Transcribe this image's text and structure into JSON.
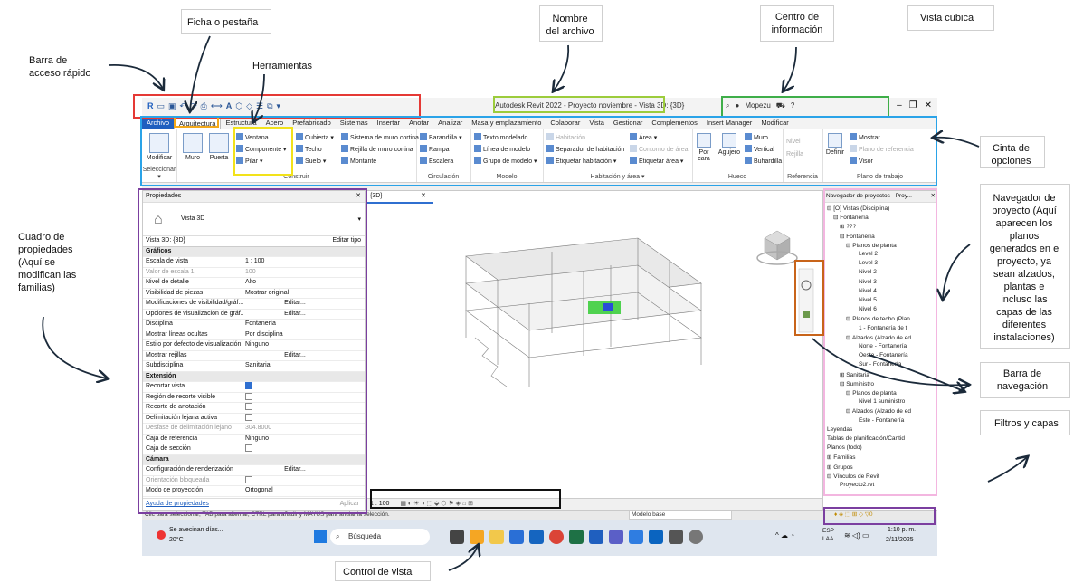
{
  "annotations": {
    "quick_access": "Barra de\nacceso rápido",
    "tab": "Ficha o pestaña",
    "tools": "Herramientas",
    "file_name": "Nombre\ndel archivo",
    "info_center": "Centro de\ninformación",
    "view_cube": "Vista cubica",
    "ribbon": "Cinta de\nopciones",
    "properties": "Cuadro de\npropiedades\n(Aquí se\nmodifican las\nfamilias)",
    "project_browser": "Navegador de\nproyecto (Aquí\naparecen los\nplanos\ngenerados en e\nproyecto, ya\nsean alzados,\nplantas e\nincluso las\ncapas de las\ndiferentes\ninstalaciones)",
    "nav_bar": "Barra de\nnavegación",
    "filters": "Filtros y capas",
    "view_control": "Control de vista"
  },
  "colors": {
    "red": "#e53935",
    "green": "#3fae49",
    "lime": "#9ccc3c",
    "blue": "#2aa3e8",
    "yellow": "#f2e21a",
    "purple": "#7b3fa0",
    "pink": "#f3b6e0",
    "orange": "#c8641a",
    "black": "#111111",
    "arrow": "#1b2a3a"
  },
  "app": {
    "title": "Autodesk Revit 2022 - Proyecto noviembre - Vista 3D: {3D}",
    "user": "Mopezu",
    "tabs": [
      "Archivo",
      "Arquitectura",
      "Estructura",
      "Acero",
      "Prefabricado",
      "Sistemas",
      "Insertar",
      "Anotar",
      "Analizar",
      "Masa y emplazamiento",
      "Colaborar",
      "Vista",
      "Gestionar",
      "Complementos",
      "Insert Manager",
      "Modificar"
    ],
    "ribbon": {
      "modify": "Modificar",
      "select": "Seleccionar ▾",
      "wall": "Muro",
      "door": "Puerta",
      "window": "Ventana",
      "component": "Componente ▾",
      "column": "Pilar ▾",
      "roof": "Cubierta ▾",
      "ceiling": "Techo",
      "floor": "Suelo ▾",
      "curtain_system": "Sistema de muro cortina",
      "curtain_grid": "Rejilla de muro cortina",
      "mullion": "Montante",
      "build": "Construir",
      "railing": "Barandilla ▾",
      "ramp": "Rampa",
      "stair": "Escalera",
      "circulation": "Circulación",
      "model_text": "Texto modelado",
      "model_line": "Línea de modelo",
      "model_group": "Grupo de modelo ▾",
      "model": "Modelo",
      "room": "Habitación",
      "room_sep": "Separador de habitación",
      "tag_room": "Etiquetar habitación ▾",
      "area": "Área ▾",
      "area_boundary": "Contorno de área",
      "tag_area": "Etiquetar área ▾",
      "room_area": "Habitación y área ▾",
      "by_face": "Por\ncara",
      "shaft": "Agujero",
      "wall_op": "Muro",
      "vertical": "Vertical",
      "dormer": "Buhardilla",
      "opening": "Hueco",
      "level": "Nivel",
      "grid": "Rejilla",
      "datum": "Referencia",
      "set": "Definir",
      "show": "Mostrar",
      "ref_plane": "Plano de referencia",
      "viewer": "Visor",
      "workplane": "Plano de trabajo"
    },
    "properties": {
      "title": "Propiedades",
      "type": "Vista 3D",
      "selector": "Vista 3D: {3D}",
      "edit_type": "Editar tipo",
      "help": "Ayuda de propiedades",
      "apply": "Aplicar",
      "rows": [
        {
          "k": "Gráficos",
          "v": "",
          "sec": true
        },
        {
          "k": "Escala de vista",
          "v": "1 : 100"
        },
        {
          "k": "Valor de escala    1:",
          "v": "100",
          "dis": true
        },
        {
          "k": "Nivel de detalle",
          "v": "Alto"
        },
        {
          "k": "Visibilidad de piezas",
          "v": "Mostrar original"
        },
        {
          "k": "Modificaciones de visibilidad/gráf...",
          "v": "Editar..."
        },
        {
          "k": "Opciones de visualización de gráf...",
          "v": "Editar..."
        },
        {
          "k": "Disciplina",
          "v": "Fontanería"
        },
        {
          "k": "Mostrar líneas ocultas",
          "v": "Por disciplina"
        },
        {
          "k": "Estilo por defecto de visualización...",
          "v": "Ninguno"
        },
        {
          "k": "Mostrar rejillas",
          "v": "Editar..."
        },
        {
          "k": "Subdisciplina",
          "v": "Sanitaria"
        },
        {
          "k": "Extensión",
          "v": "",
          "sec": true
        },
        {
          "k": "Recortar vista",
          "v": "cb-on"
        },
        {
          "k": "Región de recorte visible",
          "v": "cb"
        },
        {
          "k": "Recorte de anotación",
          "v": "cb"
        },
        {
          "k": "Delimitación lejana activa",
          "v": "cb"
        },
        {
          "k": "Desfase de delimitación lejano",
          "v": "304.8000",
          "dis": true
        },
        {
          "k": "Caja de referencia",
          "v": "Ninguno"
        },
        {
          "k": "Caja de sección",
          "v": "cb"
        },
        {
          "k": "Cámara",
          "v": "",
          "sec": true
        },
        {
          "k": "Configuración de renderización",
          "v": "Editar..."
        },
        {
          "k": "Orientación bloqueada",
          "v": "cb",
          "dis": true
        },
        {
          "k": "Modo de proyección",
          "v": "Ortogonal"
        }
      ]
    },
    "view": {
      "tab": "{3D}",
      "scale": "1 : 100",
      "model_base": "Modelo base"
    },
    "browser": {
      "title": "Navegador de proyectos - Proy...",
      "nodes": [
        {
          "t": "⊟ [O] Vistas (Disciplina)",
          "d": 0
        },
        {
          "t": "⊟ Fontanería",
          "d": 1
        },
        {
          "t": "⊞ ???",
          "d": 2
        },
        {
          "t": "⊟ Fontanería",
          "d": 2
        },
        {
          "t": "⊟ Planos de planta",
          "d": 3
        },
        {
          "t": "Level 2",
          "d": 5
        },
        {
          "t": "Level 3",
          "d": 5
        },
        {
          "t": "Nivel 2",
          "d": 5
        },
        {
          "t": "Nivel 3",
          "d": 5
        },
        {
          "t": "Nivel 4",
          "d": 5
        },
        {
          "t": "Nivel 5",
          "d": 5
        },
        {
          "t": "Nivel 6",
          "d": 5
        },
        {
          "t": "⊟ Planos de techo (Plan",
          "d": 3
        },
        {
          "t": "1 - Fontanería de t",
          "d": 5
        },
        {
          "t": "⊟ Alzados (Alzado de ed",
          "d": 3
        },
        {
          "t": "Norte - Fontanería",
          "d": 5
        },
        {
          "t": "Oeste - Fontanería",
          "d": 5
        },
        {
          "t": "Sur - Fontanería",
          "d": 5
        },
        {
          "t": "⊞ Sanitaria",
          "d": 2
        },
        {
          "t": "⊟ Suministro",
          "d": 2
        },
        {
          "t": "⊟ Planos de planta",
          "d": 3
        },
        {
          "t": "Nivel 1 suministro",
          "d": 5
        },
        {
          "t": "⊟ Alzados (Alzado de ed",
          "d": 3
        },
        {
          "t": "Este - Fontanería",
          "d": 5
        },
        {
          "t": "Leyendas",
          "d": 0
        },
        {
          "t": "Tablas de planificación/Cantid",
          "d": 0
        },
        {
          "t": "Planos (todo)",
          "d": 0
        },
        {
          "t": "⊞ Familias",
          "d": 0
        },
        {
          "t": "⊞ Grupos",
          "d": 0
        },
        {
          "t": "⊟ Vínculos de Revit",
          "d": 0
        },
        {
          "t": "Proyecto2.rvt",
          "d": 2
        }
      ]
    },
    "status": "Clic para seleccionar, TAB para alternar, CTRL para añadir y MAYÚS para anular la selección.",
    "taskbar": {
      "weather": "Se avecinan días...",
      "temp": "20°C",
      "search": "Búsqueda",
      "lang": "ESP\nLAA",
      "time": "1:10 p. m.",
      "date": "2/11/2025"
    }
  }
}
